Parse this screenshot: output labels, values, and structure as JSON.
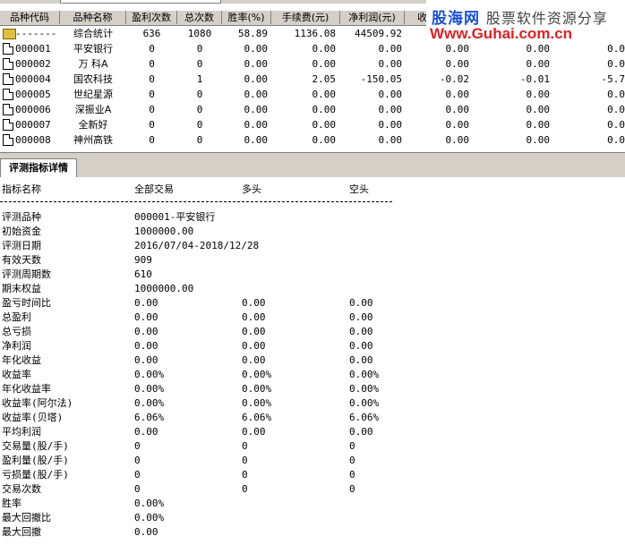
{
  "table": {
    "headers": [
      "品种代码",
      "品种名称",
      "盈利次数",
      "总次数",
      "胜率(%)",
      "手续费(元)",
      "净利润(元)",
      "收"
    ],
    "rows": [
      {
        "code": "-------",
        "name": "综合统计",
        "win": "636",
        "total": "1080",
        "rate": "58.89",
        "fee": "1136.08",
        "profit": "44509.92",
        "c8": "",
        "c9": "",
        "c10": "",
        "icon": "summary-icon"
      },
      {
        "code": "000001",
        "name": "平安银行",
        "win": "0",
        "total": "0",
        "rate": "0.00",
        "fee": "0.00",
        "profit": "0.00",
        "c8": "0.00",
        "c9": "0.00",
        "c10": "0.0",
        "icon": "document-icon"
      },
      {
        "code": "000002",
        "name": "万 科A",
        "win": "0",
        "total": "0",
        "rate": "0.00",
        "fee": "0.00",
        "profit": "0.00",
        "c8": "0.00",
        "c9": "0.00",
        "c10": "0.0",
        "icon": "document-icon"
      },
      {
        "code": "000004",
        "name": "国农科技",
        "win": "0",
        "total": "1",
        "rate": "0.00",
        "fee": "2.05",
        "profit": "-150.05",
        "c8": "-0.02",
        "c9": "-0.01",
        "c10": "-5.7",
        "icon": "document-icon"
      },
      {
        "code": "000005",
        "name": "世纪星源",
        "win": "0",
        "total": "0",
        "rate": "0.00",
        "fee": "0.00",
        "profit": "0.00",
        "c8": "0.00",
        "c9": "0.00",
        "c10": "0.0",
        "icon": "document-icon"
      },
      {
        "code": "000006",
        "name": "深振业A",
        "win": "0",
        "total": "0",
        "rate": "0.00",
        "fee": "0.00",
        "profit": "0.00",
        "c8": "0.00",
        "c9": "0.00",
        "c10": "0.0",
        "icon": "document-icon"
      },
      {
        "code": "000007",
        "name": "全新好",
        "win": "0",
        "total": "0",
        "rate": "0.00",
        "fee": "0.00",
        "profit": "0.00",
        "c8": "0.00",
        "c9": "0.00",
        "c10": "0.0",
        "icon": "document-icon"
      },
      {
        "code": "000008",
        "name": "神州高铁",
        "win": "0",
        "total": "0",
        "rate": "0.00",
        "fee": "0.00",
        "profit": "0.00",
        "c8": "0.00",
        "c9": "0.00",
        "c10": "0.0",
        "icon": "document-icon"
      }
    ]
  },
  "watermark": {
    "line1_a": "股海网",
    "line1_b": "股票软件资源分享",
    "line2": "Www.Guhai.com.cn"
  },
  "tabs": {
    "active_label": "评测指标详情"
  },
  "details": {
    "header": {
      "name": "指标名称",
      "all": "全部交易",
      "long": "多头",
      "short": "空头"
    },
    "rows": [
      {
        "name": "评测品种",
        "all": "000001-平安银行",
        "long": "",
        "short": ""
      },
      {
        "name": "初始资金",
        "all": "1000000.00",
        "long": "",
        "short": ""
      },
      {
        "name": "评测日期",
        "all": "2016/07/04-2018/12/28",
        "long": "",
        "short": ""
      },
      {
        "name": "有效天数",
        "all": "909",
        "long": "",
        "short": ""
      },
      {
        "name": "评测周期数",
        "all": "610",
        "long": "",
        "short": ""
      },
      {
        "name": "期末权益",
        "all": "1000000.00",
        "long": "",
        "short": ""
      },
      {
        "name": "盈亏时间比",
        "all": "0.00",
        "long": "0.00",
        "short": "0.00"
      },
      {
        "name": "总盈利",
        "all": "0.00",
        "long": "0.00",
        "short": "0.00"
      },
      {
        "name": "总亏损",
        "all": "0.00",
        "long": "0.00",
        "short": "0.00"
      },
      {
        "name": "净利润",
        "all": "0.00",
        "long": "0.00",
        "short": "0.00"
      },
      {
        "name": "年化收益",
        "all": "0.00",
        "long": "0.00",
        "short": "0.00"
      },
      {
        "name": "收益率",
        "all": "0.00%",
        "long": "0.00%",
        "short": "0.00%"
      },
      {
        "name": "年化收益率",
        "all": "0.00%",
        "long": "0.00%",
        "short": "0.00%"
      },
      {
        "name": "收益率(阿尔法)",
        "all": "0.00%",
        "long": "0.00%",
        "short": "0.00%"
      },
      {
        "name": "收益率(贝塔)",
        "all": "6.06%",
        "long": "6.06%",
        "short": "6.06%"
      },
      {
        "name": "平均利润",
        "all": "0.00",
        "long": "0.00",
        "short": "0.00"
      },
      {
        "name": "交易量(股/手)",
        "all": "0",
        "long": "0",
        "short": "0"
      },
      {
        "name": "盈利量(股/手)",
        "all": "0",
        "long": "0",
        "short": "0"
      },
      {
        "name": "亏损量(股/手)",
        "all": "0",
        "long": "0",
        "short": "0"
      },
      {
        "name": "交易次数",
        "all": "0",
        "long": "0",
        "short": "0"
      },
      {
        "name": "胜率",
        "all": "0.00%",
        "long": "",
        "short": ""
      },
      {
        "name": "最大回撤比",
        "all": "0.00%",
        "long": "",
        "short": ""
      },
      {
        "name": "最大回撤",
        "all": "0.00",
        "long": "",
        "short": ""
      }
    ]
  }
}
